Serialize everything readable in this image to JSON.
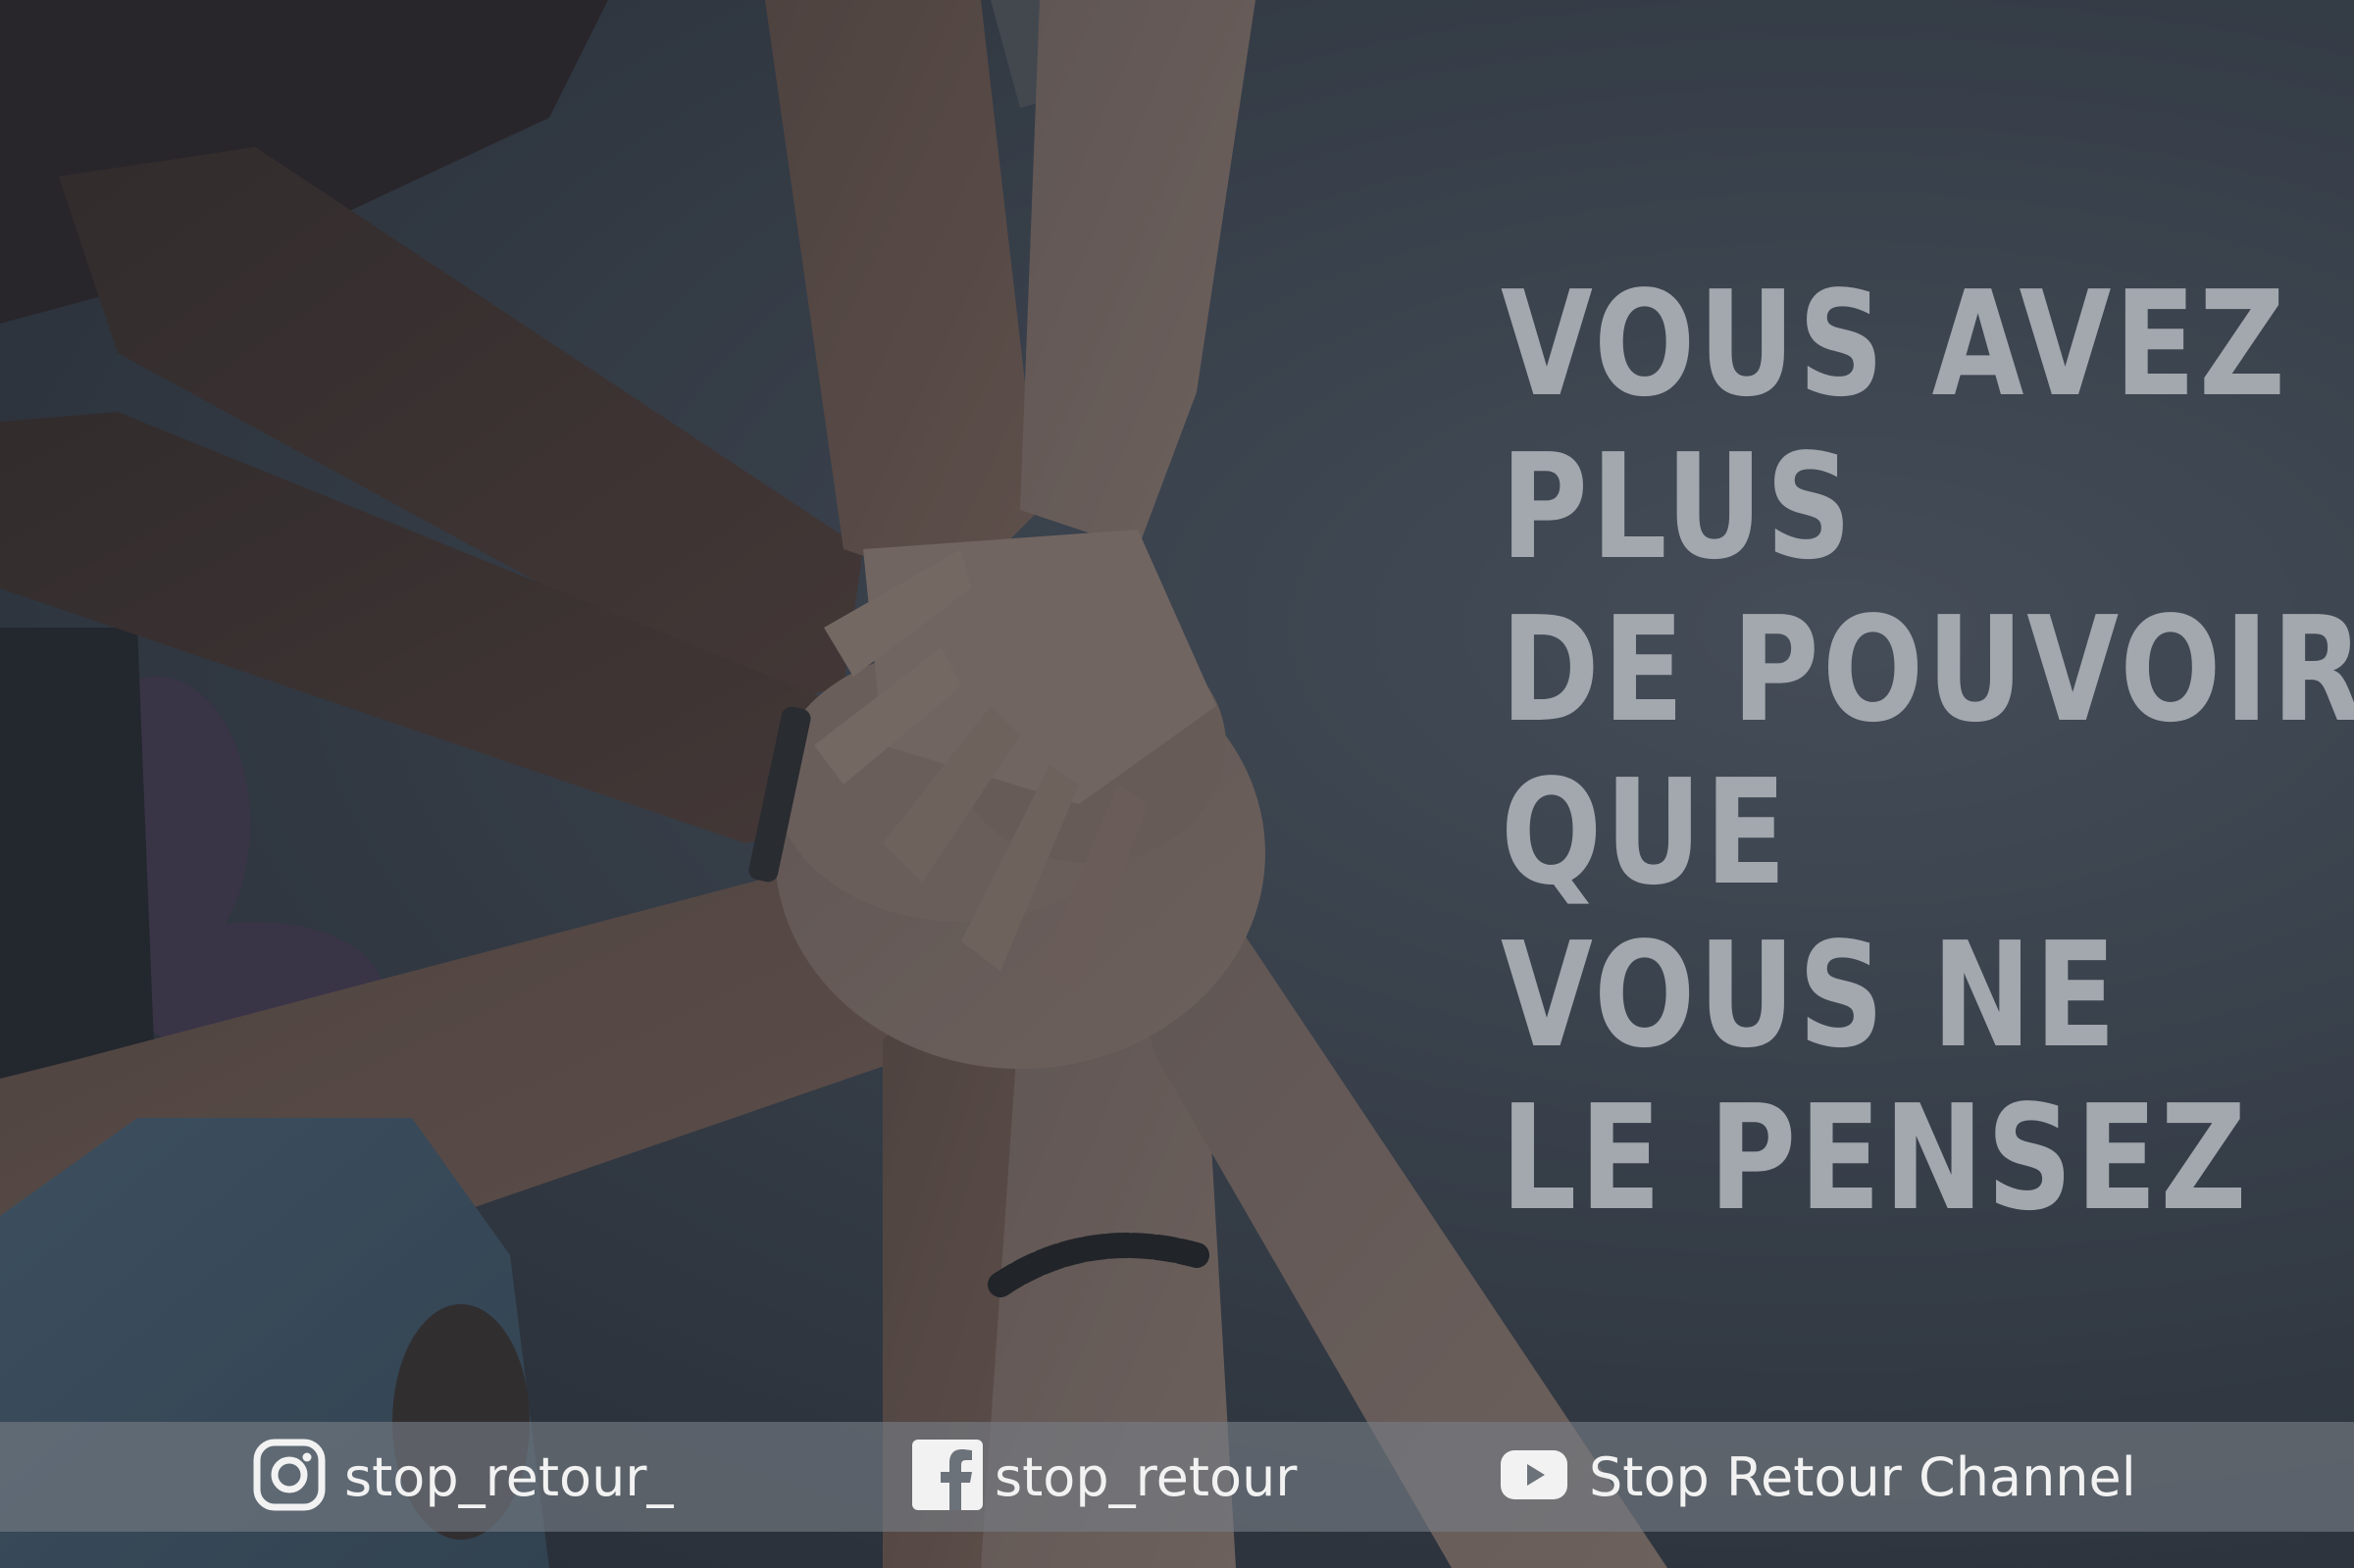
{
  "quote": {
    "lines": [
      "VOUS AVEZ",
      "PLUS",
      "DE POUVOIR",
      "QUE",
      "VOUS NE",
      "LE PENSEZ"
    ]
  },
  "social": {
    "instagram": {
      "icon": "instagram-icon",
      "handle": "stop_retour_"
    },
    "facebook": {
      "icon": "facebook-icon",
      "handle": "stop_retour"
    },
    "youtube": {
      "icon": "youtube-icon",
      "handle": "Stop Retour Channel"
    }
  },
  "colors": {
    "quote_text": "#a3a8ae",
    "bar_text": "#f2f2f2",
    "overlay": "#3a414b"
  }
}
